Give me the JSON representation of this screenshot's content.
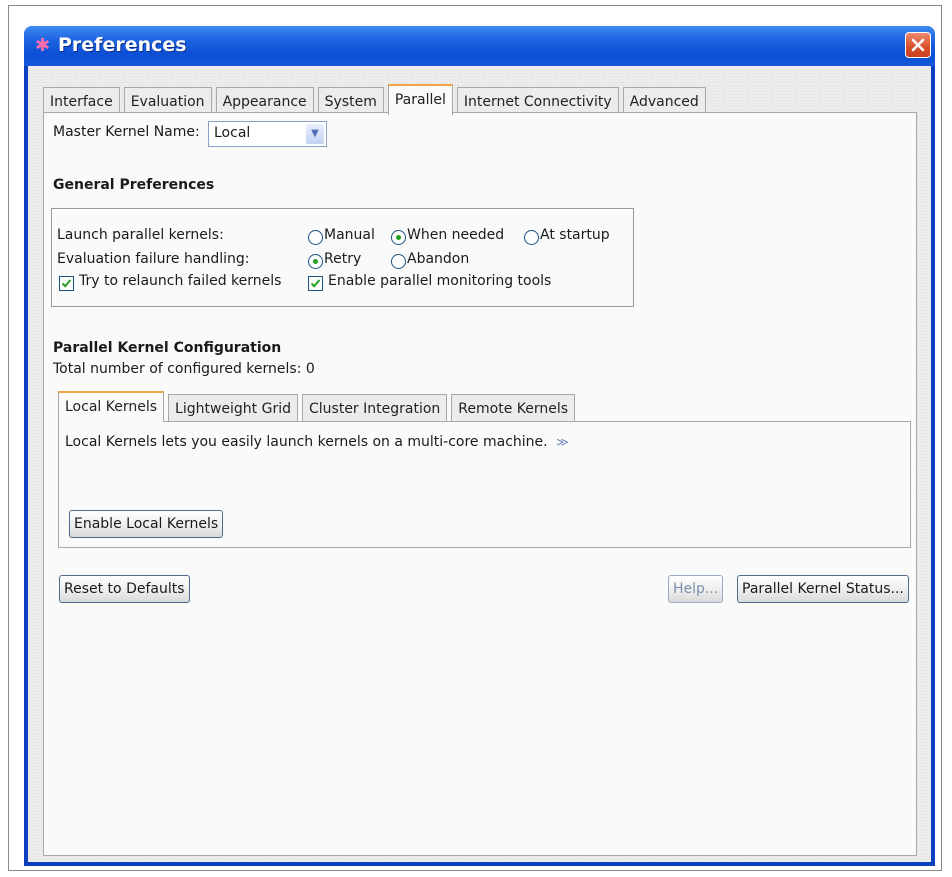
{
  "window": {
    "title": "Preferences"
  },
  "tabs": [
    "Interface",
    "Evaluation",
    "Appearance",
    "System",
    "Parallel",
    "Internet Connectivity",
    "Advanced"
  ],
  "active_tab": "Parallel",
  "master_kernel": {
    "label": "Master Kernel Name:",
    "value": "Local"
  },
  "general": {
    "heading": "General Preferences",
    "launch_label": "Launch parallel kernels:",
    "launch_options": [
      "Manual",
      "When needed",
      "At startup"
    ],
    "launch_selected": "When needed",
    "failure_label": "Evaluation failure handling:",
    "failure_options": [
      "Retry",
      "Abandon"
    ],
    "failure_selected": "Retry",
    "relaunch_label": "Try to relaunch failed kernels",
    "relaunch_checked": true,
    "monitoring_label": "Enable parallel monitoring tools",
    "monitoring_checked": true
  },
  "config": {
    "heading": "Parallel Kernel Configuration",
    "total_text": "Total number of configured kernels: 0",
    "subtabs": [
      "Local Kernels",
      "Lightweight Grid",
      "Cluster Integration",
      "Remote Kernels"
    ],
    "active_subtab": "Local Kernels",
    "description": "Local Kernels lets you easily launch kernels on a multi-core machine.",
    "more_glyph": "≫",
    "enable_button": "Enable Local Kernels"
  },
  "buttons": {
    "reset": "Reset to Defaults",
    "help": "Help...",
    "status": "Parallel Kernel Status..."
  },
  "colors": {
    "title_bar": "#0b4fd6",
    "active_tab_accent": "#f4a341",
    "radio_dot": "#21a121"
  }
}
